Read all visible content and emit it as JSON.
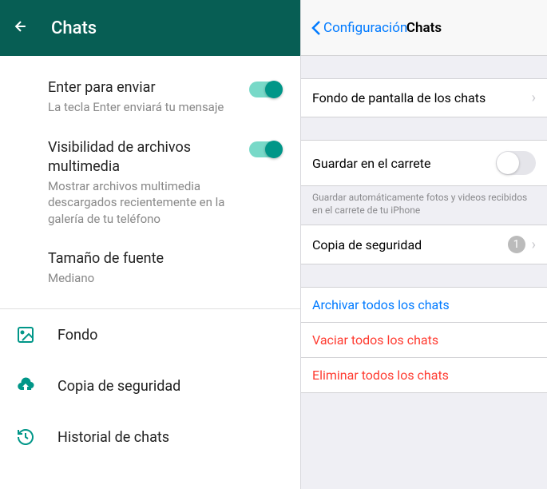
{
  "android": {
    "header": {
      "title": "Chats"
    },
    "enter": {
      "title": "Enter para enviar",
      "sub": "La tecla Enter enviará tu mensaje"
    },
    "media": {
      "title": "Visibilidad de archivos multimedia",
      "sub": "Mostrar archivos multimedia descargados recientemente en la galería de tu teléfono"
    },
    "fontsize": {
      "title": "Tamaño de fuente",
      "sub": "Mediano"
    },
    "wallpaper_label": "Fondo",
    "backup_label": "Copia de seguridad",
    "history_label": "Historial de chats"
  },
  "ios": {
    "back": "Configuración",
    "title": "Chats",
    "wallpaper": "Fondo de pantalla de los chats",
    "save": {
      "label": "Guardar en el carrete",
      "footer": "Guardar automáticamente fotos y videos recibidos en el carrete de tu iPhone"
    },
    "backup": {
      "label": "Copia de seguridad",
      "badge": "1"
    },
    "archive": "Archivar todos los chats",
    "clear": "Vaciar todos los chats",
    "delete": "Eliminar todos los chats"
  }
}
